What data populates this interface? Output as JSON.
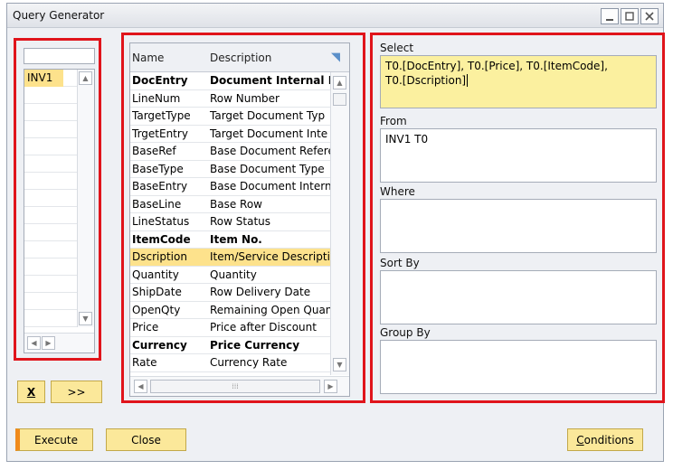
{
  "window": {
    "title": "Query Generator"
  },
  "tables": {
    "search_value": "",
    "items": [
      "INV1",
      "",
      "",
      "",
      "",
      "",
      "",
      "",
      "",
      "",
      "",
      "",
      "",
      "",
      ""
    ]
  },
  "columns": {
    "headers": {
      "name": "Name",
      "description": "Description"
    },
    "rows": [
      {
        "name": "DocEntry",
        "description": "Document Internal I",
        "bold": true,
        "selected": false
      },
      {
        "name": "LineNum",
        "description": "Row Number",
        "bold": false,
        "selected": false
      },
      {
        "name": "TargetType",
        "description": "Target Document Typ",
        "bold": false,
        "selected": false
      },
      {
        "name": "TrgetEntry",
        "description": "Target Document Inte",
        "bold": false,
        "selected": false
      },
      {
        "name": "BaseRef",
        "description": "Base Document Refere",
        "bold": false,
        "selected": false
      },
      {
        "name": "BaseType",
        "description": "Base Document Type",
        "bold": false,
        "selected": false
      },
      {
        "name": "BaseEntry",
        "description": "Base Document Intern",
        "bold": false,
        "selected": false
      },
      {
        "name": "BaseLine",
        "description": "Base Row",
        "bold": false,
        "selected": false
      },
      {
        "name": "LineStatus",
        "description": "Row Status",
        "bold": false,
        "selected": false
      },
      {
        "name": "ItemCode",
        "description": "Item No.",
        "bold": true,
        "selected": false
      },
      {
        "name": "Dscription",
        "description": "Item/Service Descriptio",
        "bold": false,
        "selected": true
      },
      {
        "name": "Quantity",
        "description": "Quantity",
        "bold": false,
        "selected": false
      },
      {
        "name": "ShipDate",
        "description": "Row Delivery Date",
        "bold": false,
        "selected": false
      },
      {
        "name": "OpenQty",
        "description": "Remaining Open Quant",
        "bold": false,
        "selected": false
      },
      {
        "name": "Price",
        "description": "Price after Discount",
        "bold": false,
        "selected": false
      },
      {
        "name": "Currency",
        "description": "Price Currency",
        "bold": true,
        "selected": false
      },
      {
        "name": "Rate",
        "description": "Currency Rate",
        "bold": false,
        "selected": false
      }
    ]
  },
  "query": {
    "select_label": "Select",
    "select_line1": "T0.[DocEntry], T0.[Price], T0.[ItemCode],",
    "select_line2": "T0.[Dscription]",
    "from_label": "From",
    "from_value": "INV1 T0",
    "where_label": "Where",
    "where_value": "",
    "sort_label": "Sort By",
    "sort_value": "",
    "group_label": "Group By",
    "group_value": ""
  },
  "buttons": {
    "remove": "X",
    "add": ">>",
    "execute": "Execute",
    "close": "Close",
    "conditions_first": "C",
    "conditions_rest": "onditions"
  },
  "colors": {
    "highlight": "#fde28c",
    "select_box": "#fbf09f",
    "frame": "#e0141b"
  }
}
